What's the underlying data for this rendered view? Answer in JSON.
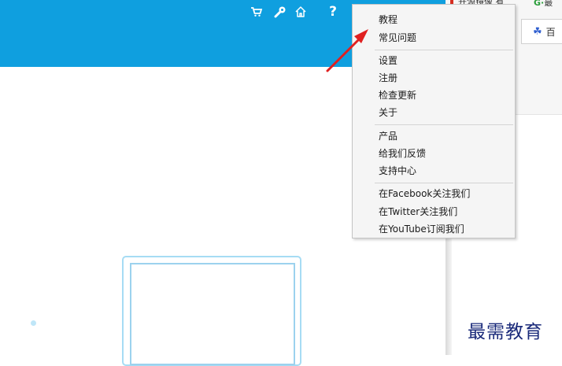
{
  "toolbar": {
    "icons": [
      "cart-icon",
      "wrench-icon",
      "home-icon",
      "help-icon"
    ],
    "help_label": "?"
  },
  "menu": {
    "group1": [
      "教程",
      "常见问题"
    ],
    "group2": [
      "设置",
      "注册",
      "检查更新",
      "关于"
    ],
    "group3": [
      "产品",
      "给我们反馈",
      "支持中心"
    ],
    "group4": [
      "在Facebook关注我们",
      "在Twitter关注我们",
      "在YouTube订阅我们"
    ]
  },
  "browser": {
    "bookmark_text": "开源镜像 有",
    "bookmark_g": "G·",
    "bookmark_g_text": "最",
    "tab_label": "百"
  },
  "watermark": "最需教育",
  "colors": {
    "header_blue": "#0f9fdf",
    "annotation_arrow": "#e02020",
    "frame_border": "#a6dcf4"
  }
}
